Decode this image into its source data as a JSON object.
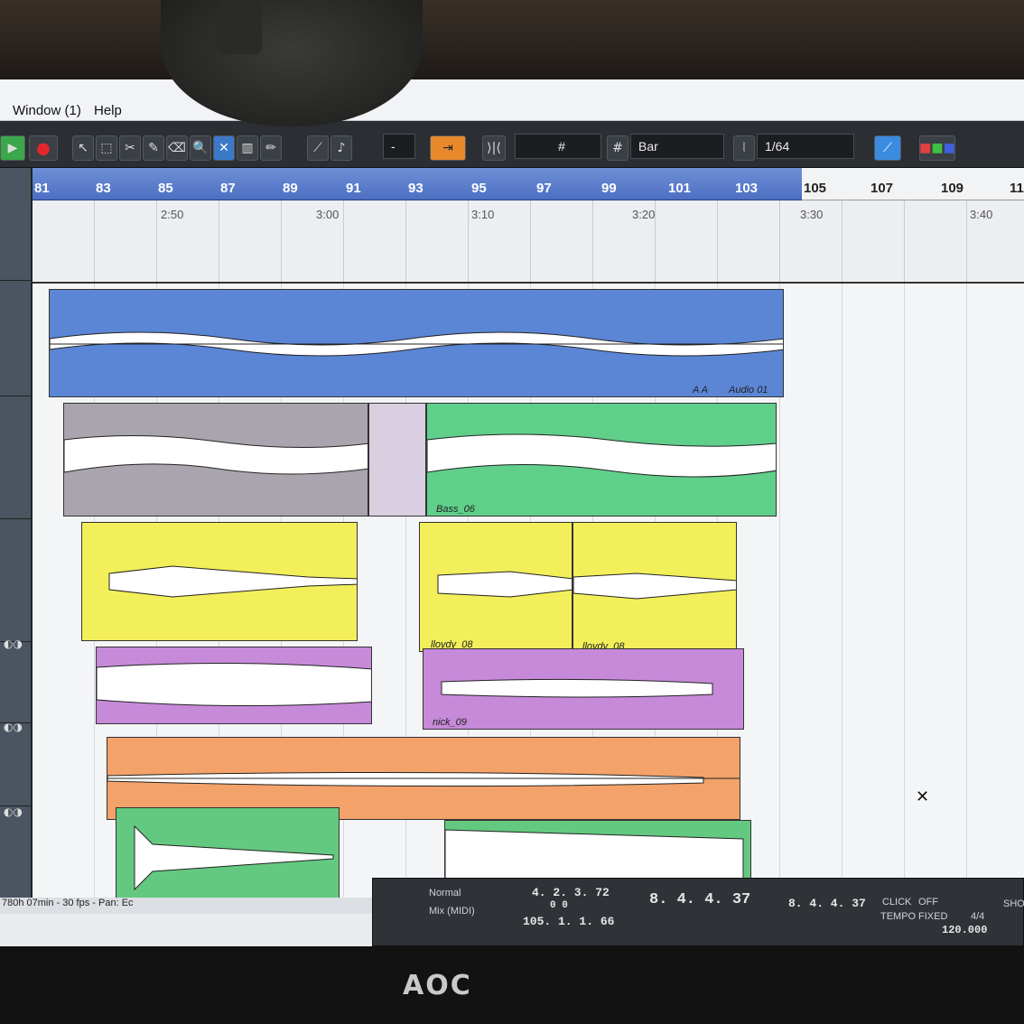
{
  "menu": {
    "items": [
      "Window (1)",
      "Help"
    ]
  },
  "toolbar": {
    "snap_value": "Bar",
    "quantize_value": "1/64",
    "snap_unit_small": "-"
  },
  "ruler": {
    "bars": [
      "81",
      "83",
      "85",
      "87",
      "89",
      "91",
      "93",
      "95",
      "97",
      "99",
      "101",
      "103",
      "105",
      "107",
      "109",
      "11"
    ],
    "times": [
      "2:50",
      "3:00",
      "3:10",
      "3:20",
      "3:30",
      "3:40"
    ]
  },
  "tracks": [
    {
      "clips": [
        {
          "name": "Audio 01",
          "extra": "A  A",
          "color": "#5b86d6"
        }
      ]
    },
    {
      "clips": [
        {
          "name": "",
          "color": "#a9a4ad"
        },
        {
          "name": "Bass_06",
          "color": "#5fcf8a"
        }
      ]
    },
    {
      "clips": [
        {
          "name": "",
          "color": "#f3ef5a"
        },
        {
          "name": "lloydy_08",
          "color": "#f3ef5a"
        },
        {
          "name": "lloydy_08",
          "color": "#f3ef5a"
        }
      ]
    },
    {
      "clips": [
        {
          "name": "",
          "color": "#c78ad9"
        },
        {
          "name": "nick_09",
          "color": "#c78ad9"
        }
      ]
    },
    {
      "clips": [
        {
          "name": "",
          "color": "#f3a26a"
        }
      ]
    },
    {
      "clips": [
        {
          "name": "",
          "color": "#64c980"
        },
        {
          "name": "",
          "color": "#64c980"
        }
      ]
    }
  ],
  "status": {
    "text": "780h 07min - 30 fps - Pan: Ec"
  },
  "transport": {
    "mode": "Normal",
    "mix": "Mix (MIDI)",
    "left_locator": "4. 2. 3. 72",
    "left_sub": "0    0",
    "right_locator": "105. 1. 1. 66",
    "position": "8. 4. 4. 37",
    "position_2": "8. 4. 4. 37",
    "click_label": "CLICK",
    "click_state": "OFF",
    "tempo_label": "TEMPO",
    "tempo_mode": "FIXED",
    "signature": "4/4",
    "tempo": "120.000",
    "show_label": "SHO"
  },
  "monitor": {
    "brand": "AOC"
  },
  "colors": {
    "ruler": "#5b7ccc",
    "toolbar": "#2b2e33"
  }
}
